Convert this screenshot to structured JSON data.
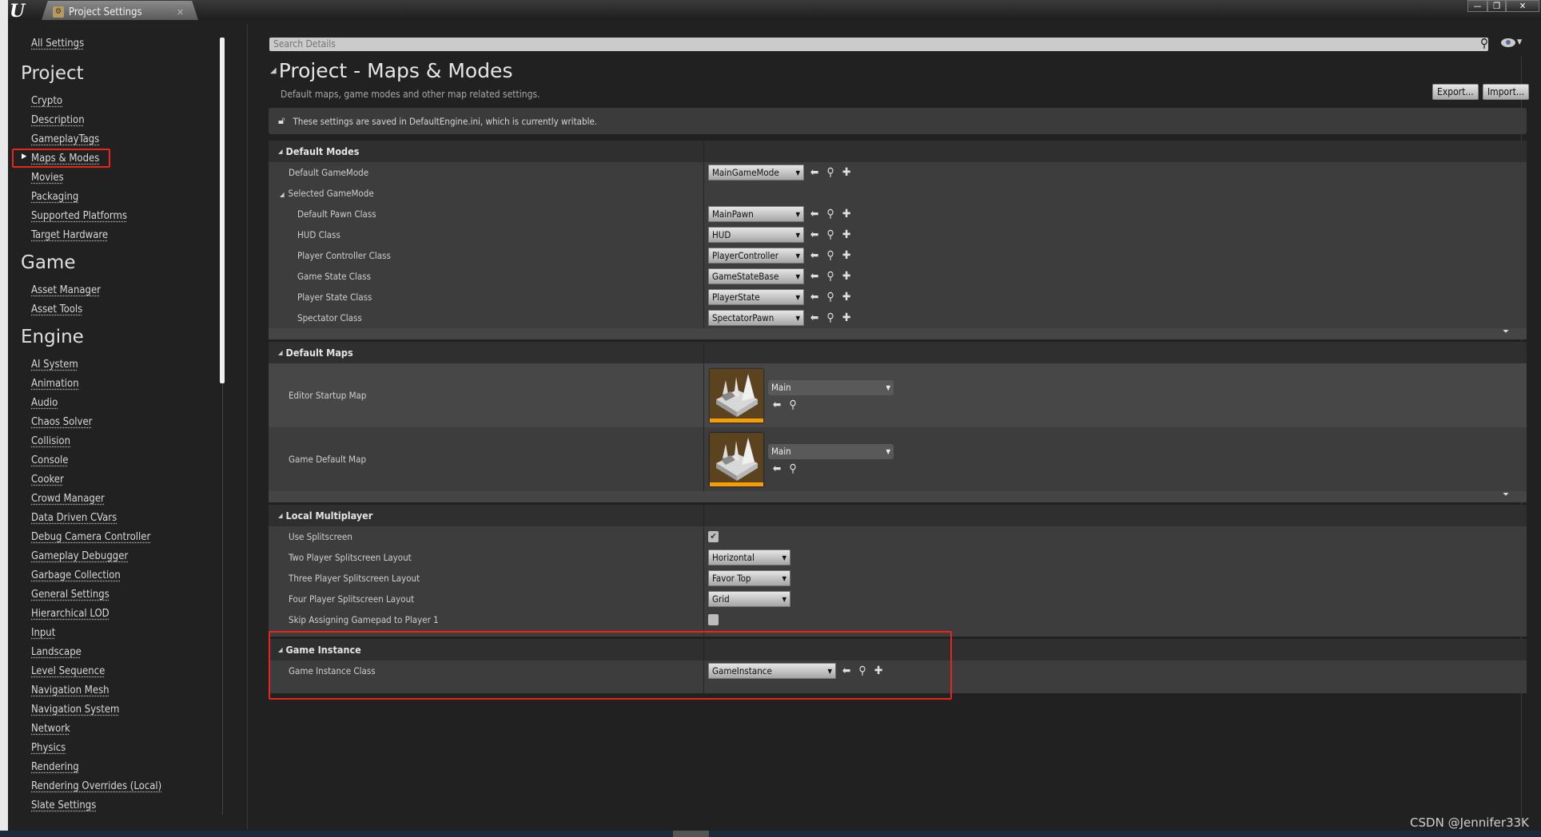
{
  "window": {
    "tab_title": "Project Settings",
    "tab_close": "×",
    "minimize": "—",
    "restore": "❐",
    "close": "✕"
  },
  "sidebar": {
    "all_settings": "All Settings",
    "selected": "Maps & Modes",
    "groups": [
      {
        "title": "Project",
        "items": [
          "Crypto",
          "Description",
          "GameplayTags",
          "Maps & Modes",
          "Movies",
          "Packaging",
          "Supported Platforms",
          "Target Hardware"
        ]
      },
      {
        "title": "Game",
        "items": [
          "Asset Manager",
          "Asset Tools"
        ]
      },
      {
        "title": "Engine",
        "items": [
          "AI System",
          "Animation",
          "Audio",
          "Chaos Solver",
          "Collision",
          "Console",
          "Cooker",
          "Crowd Manager",
          "Data Driven CVars",
          "Debug Camera Controller",
          "Gameplay Debugger",
          "Garbage Collection",
          "General Settings",
          "Hierarchical LOD",
          "Input",
          "Landscape",
          "Level Sequence",
          "Navigation Mesh",
          "Navigation System",
          "Network",
          "Physics",
          "Rendering",
          "Rendering Overrides (Local)",
          "Slate Settings"
        ]
      }
    ]
  },
  "search": {
    "placeholder": "Search Details"
  },
  "header": {
    "title": "Project - Maps & Modes",
    "description": "Default maps, game modes and other map related settings.",
    "export_label": "Export...",
    "import_label": "Import...",
    "info": "These settings are saved in DefaultEngine.ini, which is currently writable."
  },
  "sections": {
    "default_modes": {
      "title": "Default Modes",
      "rows": [
        {
          "label": "Default GameMode",
          "value": "MainGameMode",
          "indent": false
        },
        {
          "label": "Selected GameMode",
          "group": true
        },
        {
          "label": "Default Pawn Class",
          "value": "MainPawn",
          "indent": true
        },
        {
          "label": "HUD Class",
          "value": "HUD",
          "indent": true
        },
        {
          "label": "Player Controller Class",
          "value": "PlayerController",
          "indent": true
        },
        {
          "label": "Game State Class",
          "value": "GameStateBase",
          "indent": true
        },
        {
          "label": "Player State Class",
          "value": "PlayerState",
          "indent": true
        },
        {
          "label": "Spectator Class",
          "value": "SpectatorPawn",
          "indent": true
        }
      ]
    },
    "default_maps": {
      "title": "Default Maps",
      "rows": [
        {
          "label": "Editor Startup Map",
          "value": "Main"
        },
        {
          "label": "Game Default Map",
          "value": "Main"
        }
      ]
    },
    "local_multiplayer": {
      "title": "Local Multiplayer",
      "rows": [
        {
          "label": "Use Splitscreen",
          "checkbox": true,
          "checked": true
        },
        {
          "label": "Two Player Splitscreen Layout",
          "value": "Horizontal"
        },
        {
          "label": "Three Player Splitscreen Layout",
          "value": "Favor Top"
        },
        {
          "label": "Four Player Splitscreen Layout",
          "value": "Grid"
        },
        {
          "label": "Skip Assigning Gamepad to Player 1",
          "checkbox": true,
          "checked": false
        }
      ]
    },
    "game_instance": {
      "title": "Game Instance",
      "rows": [
        {
          "label": "Game Instance Class",
          "value": "GameInstance"
        }
      ]
    }
  },
  "watermark": "CSDN @Jennifer33K",
  "colors": {
    "highlight_box": "#e8261e",
    "map_thumb_accent": "#f5a000",
    "background": "#212121",
    "row": "#3d3d3d"
  }
}
